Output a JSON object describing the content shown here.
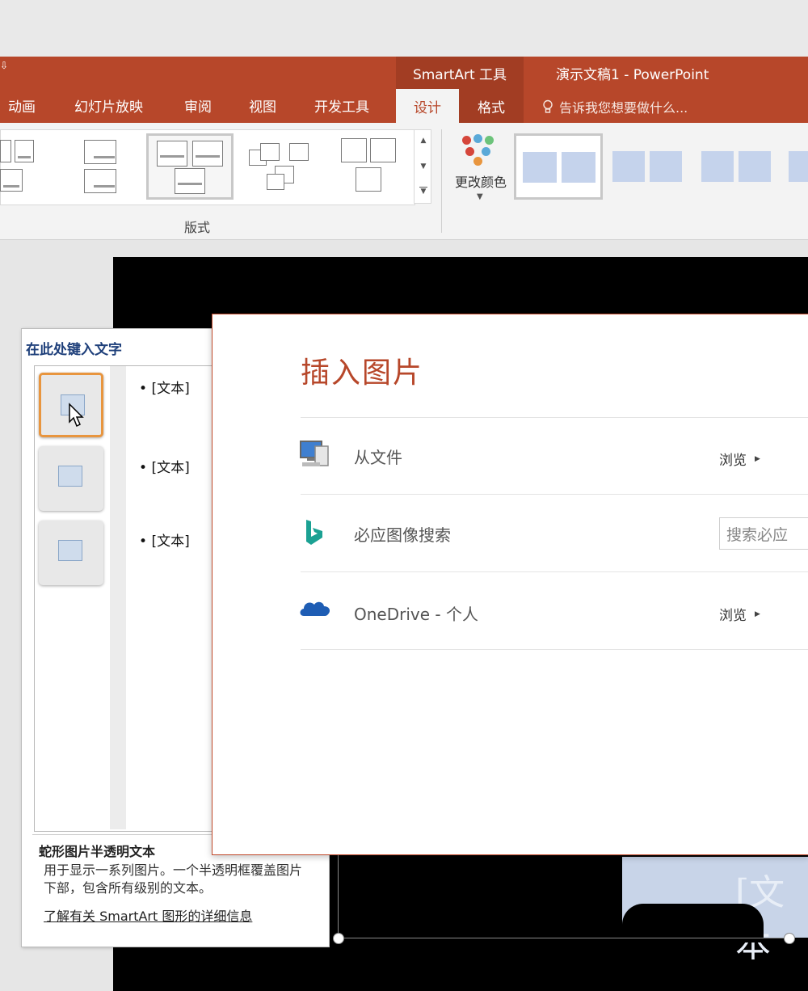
{
  "titlebar": {
    "tool_context": "SmartArt 工具",
    "document_title": "演示文稿1 - PowerPoint",
    "quick_access_arrow": "⇩"
  },
  "tabs": [
    {
      "label": "动画"
    },
    {
      "label": "幻灯片放映"
    },
    {
      "label": "审阅"
    },
    {
      "label": "视图"
    },
    {
      "label": "开发工具"
    },
    {
      "label": "设计"
    },
    {
      "label": "格式"
    }
  ],
  "tell_me": {
    "placeholder": "告诉我您想要做什么..."
  },
  "ribbon": {
    "layouts_group_label": "版式",
    "change_colors_label": "更改颜色",
    "scroll_up": "▲",
    "scroll_down": "▼",
    "scroll_more": "▼"
  },
  "text_pane": {
    "title": "在此处键入文字",
    "items": [
      {
        "text": "[文本]"
      },
      {
        "text": "[文本]"
      },
      {
        "text": "[文本]"
      }
    ],
    "layout_name": "蛇形图片半透明文本",
    "layout_description": "用于显示一系列图片。一个半透明框覆盖图片下部，包含所有级别的文本。",
    "learn_more_link": "了解有关 SmartArt 图形的详细信息"
  },
  "slide": {
    "placeholder_text": "[文本"
  },
  "insert_picture_dialog": {
    "title": "插入图片",
    "rows": [
      {
        "icon": "computer-icon",
        "label": "从文件",
        "action": "浏览"
      },
      {
        "icon": "bing-icon",
        "label": "必应图像搜索",
        "search_placeholder": "搜索必应"
      },
      {
        "icon": "onedrive-icon",
        "label": "OneDrive - 个人",
        "action": "浏览"
      }
    ]
  },
  "colors": {
    "accent": "#b7472a",
    "accent_dark": "#a23d23",
    "dialog_title": "#b7472a",
    "bing": "#1ba193",
    "onedrive": "#1e5db4"
  }
}
